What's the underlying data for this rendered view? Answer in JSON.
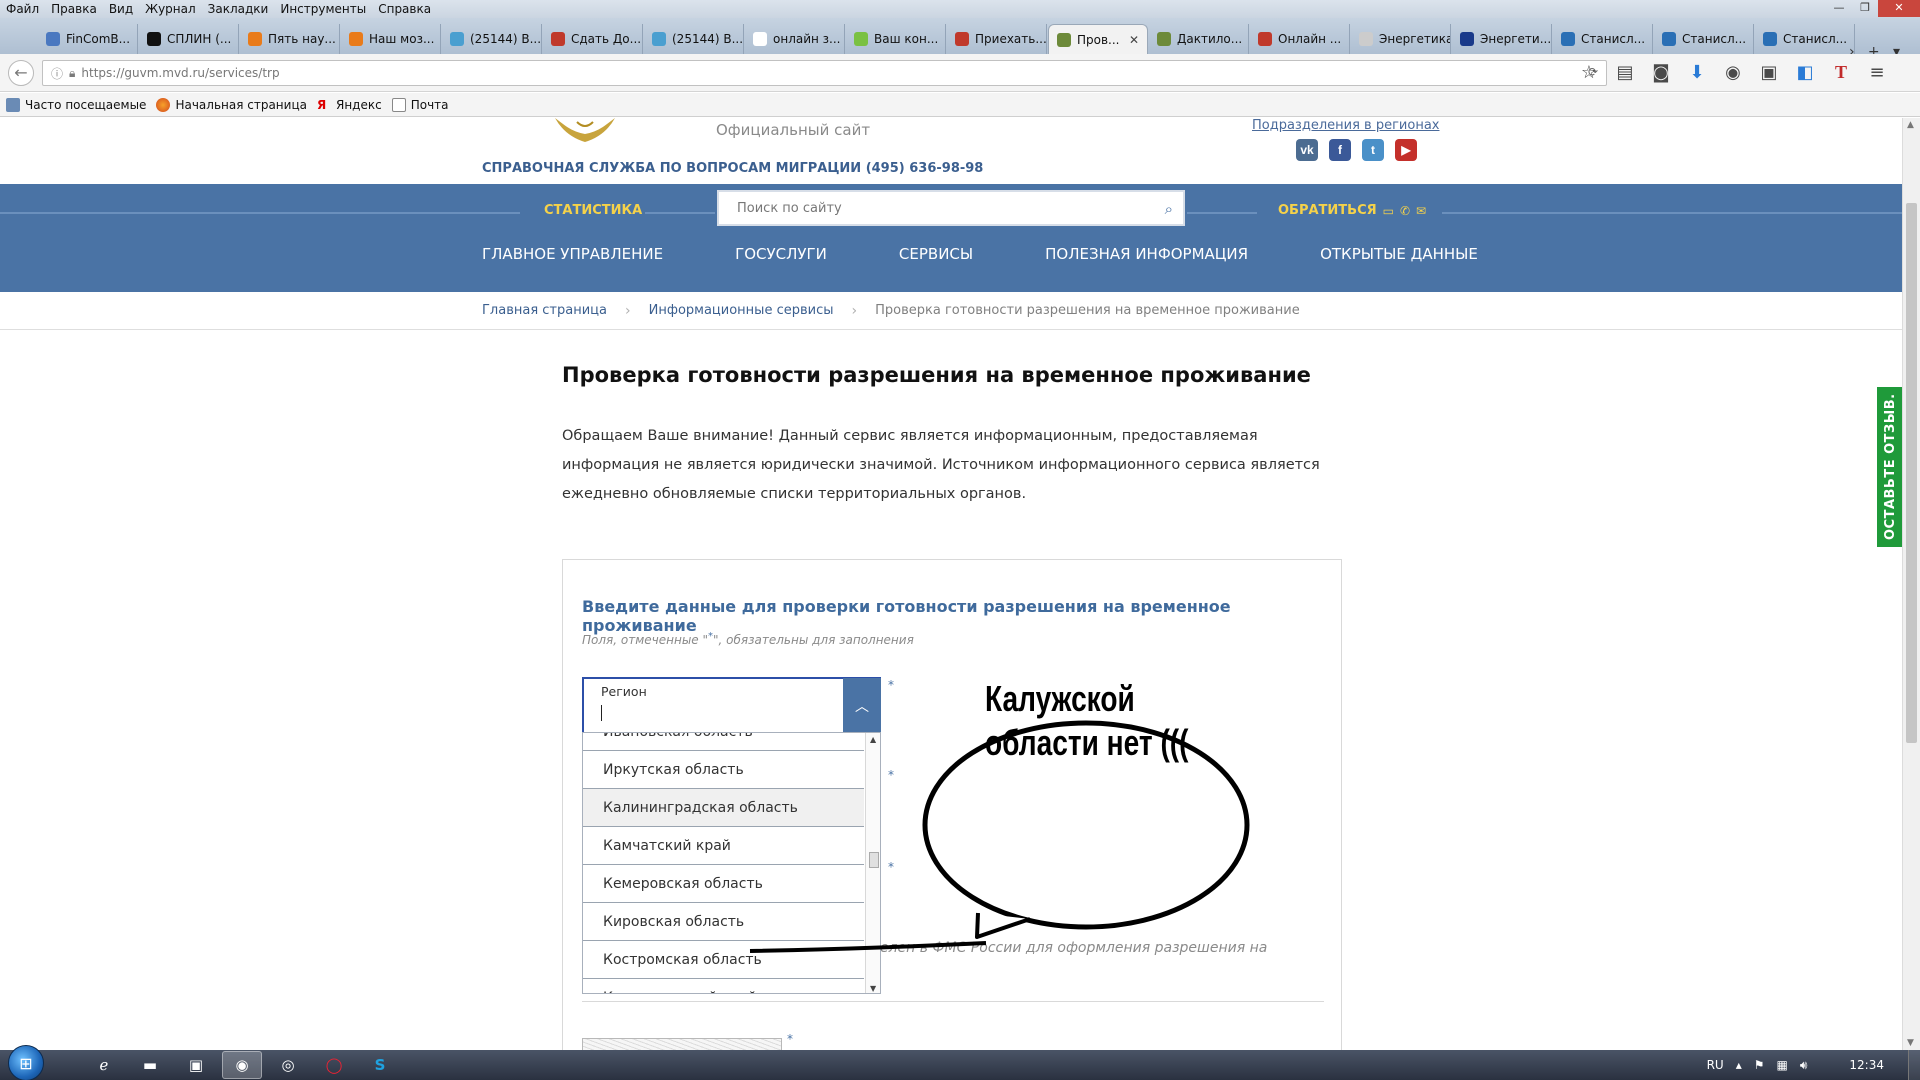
{
  "browser": {
    "menu": [
      "Файл",
      "Правка",
      "Вид",
      "Журнал",
      "Закладки",
      "Инструменты",
      "Справка"
    ],
    "tabs": [
      {
        "label": "FinComB...",
        "color": "#4a78c0"
      },
      {
        "label": "СПЛИН (...",
        "color": "#111111"
      },
      {
        "label": "Пять нау...",
        "color": "#e97b1a"
      },
      {
        "label": "Наш моз...",
        "color": "#e97b1a"
      },
      {
        "label": "(25144) В...",
        "color": "#4a9fd0"
      },
      {
        "label": "Сдать До...",
        "color": "#c0392b"
      },
      {
        "label": "(25144) В...",
        "color": "#4a9fd0"
      },
      {
        "label": "онлайн з...",
        "color": "#ffffff"
      },
      {
        "label": "Ваш кон...",
        "color": "#7ac142"
      },
      {
        "label": "Приехать...",
        "color": "#c0392b"
      },
      {
        "label": "Пров...",
        "color": "#6d8a3a",
        "active": true
      },
      {
        "label": "Дактило...",
        "color": "#6d8a3a"
      },
      {
        "label": "Онлайн ...",
        "color": "#c0392b"
      },
      {
        "label": "Энергетика Ч...",
        "color": "#cccccc"
      },
      {
        "label": "Энергети...",
        "color": "#1a3a8a"
      },
      {
        "label": "Станисл...",
        "color": "#2a6fb5"
      },
      {
        "label": "Станисл...",
        "color": "#2a6fb5"
      },
      {
        "label": "Станисл...",
        "color": "#2a6fb5"
      }
    ],
    "url": "https://guvm.mvd.ru/services/trp",
    "bookmarks": [
      "Часто посещаемые",
      "Начальная страница",
      "Яндекс",
      "Почта"
    ]
  },
  "site": {
    "subtitle": "Официальный сайт",
    "regions_link": "Подразделения в регионах",
    "socials": [
      {
        "name": "vk-icon",
        "glyph": "vk",
        "color": "#4c6c91"
      },
      {
        "name": "facebook-icon",
        "glyph": "f",
        "color": "#3b5998"
      },
      {
        "name": "twitter-icon",
        "glyph": "t",
        "color": "#4a90c8"
      },
      {
        "name": "youtube-icon",
        "glyph": "▶",
        "color": "#c4302b"
      }
    ],
    "hotline": "СПРАВОЧНАЯ СЛУЖБА ПО ВОПРОСАМ МИГРАЦИИ (495) 636-98-98",
    "stat_link": "СТАТИСТИКА",
    "search_placeholder": "Поиск по сайту",
    "contact_link": "ОБРАТИТЬСЯ",
    "nav": [
      "ГЛАВНОЕ УПРАВЛЕНИЕ",
      "ГОСУСЛУГИ",
      "СЕРВИСЫ",
      "ПОЛЕЗНАЯ ИНФОРМАЦИЯ",
      "ОТКРЫТЫЕ ДАННЫЕ"
    ],
    "breadcrumbs": [
      "Главная страница",
      "Информационные сервисы"
    ],
    "breadcrumb_current": "Проверка готовности разрешения на временное проживание",
    "feedback": "ОСТАВЬТЕ ОТЗЫВ."
  },
  "content": {
    "title": "Проверка готовности разрешения на временное проживание",
    "notice": "Обращаем Ваше внимание! Данный сервис является информационным, предоставляемая информация не является юридически значимой. Источником информационного сервиса является ежедневно обновляемые списки территориальных органов.",
    "form_title": "Введите данные для проверки готовности разрешения на временное проживание",
    "form_hint_pre": "Поля, отмеченные \"",
    "form_hint_mark": "*",
    "form_hint_post": "\", обязательны для заполнения",
    "region_label": "Регион",
    "obscured_text": "елен в ФМС России для оформления разрешения на",
    "regions": [
      "Ивановская область",
      "Иркутская область",
      "Калининградская область",
      "Камчатский край",
      "Кемеровская область",
      "Кировская область",
      "Костромская область",
      "Краснодарский край"
    ]
  },
  "annotation": {
    "text": "Калужской области нет ((("
  },
  "taskbar": {
    "lang": "RU",
    "time": "12:34"
  }
}
